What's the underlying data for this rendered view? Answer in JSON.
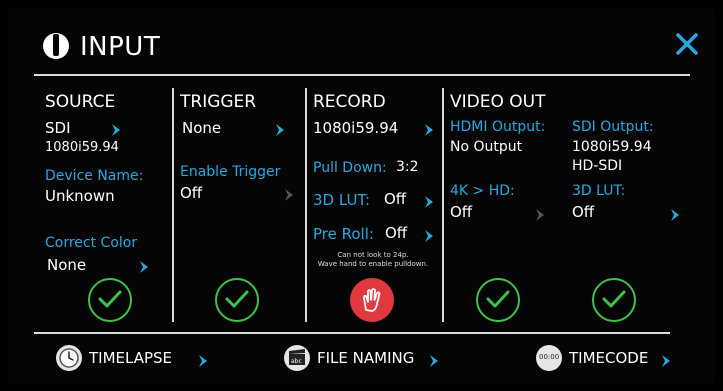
{
  "header": {
    "title": "INPUT"
  },
  "source": {
    "title": "SOURCE",
    "input": "SDI",
    "format": "1080i59.94",
    "device_name_label": "Device Name:",
    "device_name_value": "Unknown",
    "correct_color_label": "Correct Color",
    "correct_color_value": "None"
  },
  "trigger": {
    "title": "TRIGGER",
    "value": "None",
    "enable_label": "Enable Trigger",
    "enable_value": "Off"
  },
  "record": {
    "title": "RECORD",
    "format": "1080i59.94",
    "pulldown_label": "Pull Down:",
    "pulldown_value": "3:2",
    "lut_label": "3D LUT:",
    "lut_value": "Off",
    "preroll_label": "Pre Roll:",
    "preroll_value": "Off",
    "note_line1": "Can not look to 24p.",
    "note_line2": "Wave hand to enable pulldown."
  },
  "video_out": {
    "title": "VIDEO OUT",
    "hdmi_label": "HDMI Output:",
    "hdmi_value": "No Output",
    "k4hd_label": "4K > HD:",
    "k4hd_value": "Off",
    "sdi_label": "SDI Output:",
    "sdi_value1": "1080i59.94",
    "sdi_value2": "HD-SDI",
    "sdi_lut_label": "3D LUT:",
    "sdi_lut_value": "Off"
  },
  "footer": {
    "timelapse": "TIMELAPSE",
    "file_naming": "FILE NAMING",
    "timecode": "TIMECODE",
    "file_icon_text": "abc",
    "timecode_icon_text": "00:00"
  },
  "colors": {
    "accent": "#29a8e0",
    "ok": "#3cc24a",
    "warn": "#e0393f"
  }
}
